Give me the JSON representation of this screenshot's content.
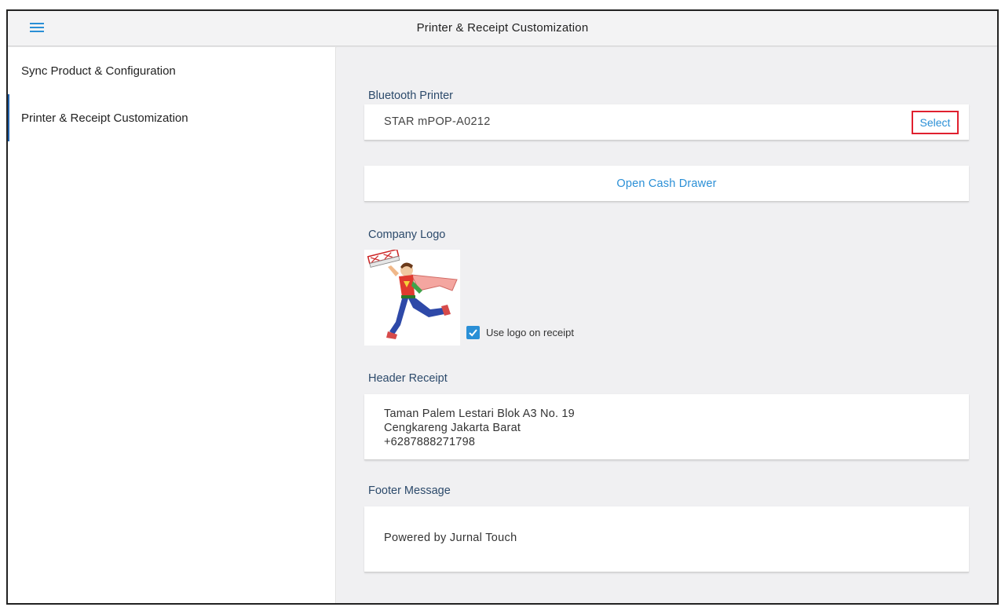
{
  "appbar": {
    "title": "Printer & Receipt Customization"
  },
  "sidebar": {
    "items": [
      {
        "label": "Sync Product & Configuration",
        "active": false
      },
      {
        "label": "Printer & Receipt Customization",
        "active": true
      }
    ]
  },
  "printer": {
    "section_label": "Bluetooth Printer",
    "device_name": "STAR mPOP-A0212",
    "select_label": "Select"
  },
  "cash_drawer": {
    "button_label": "Open Cash Drawer"
  },
  "logo": {
    "section_label": "Company Logo",
    "use_logo_label": "Use logo on receipt",
    "use_logo_checked": true
  },
  "header_receipt": {
    "section_label": "Header Receipt",
    "lines": [
      "Taman Palem Lestari Blok A3 No. 19",
      "Cengkareng Jakarta Barat",
      "+6287888271798"
    ]
  },
  "footer": {
    "section_label": "Footer Message",
    "message": "Powered by Jurnal Touch"
  },
  "colors": {
    "accent": "#2a8fd6",
    "highlight_border": "#e0202f",
    "section_label": "#2c4a6b"
  }
}
